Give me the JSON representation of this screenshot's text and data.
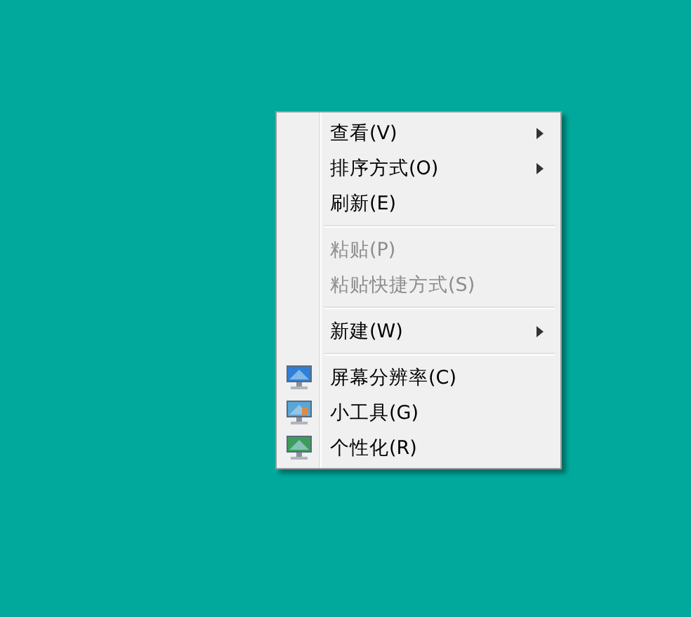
{
  "context_menu": {
    "items": [
      {
        "kind": "item",
        "label": "查看(V)",
        "submenu": true,
        "disabled": false,
        "icon": false
      },
      {
        "kind": "item",
        "label": "排序方式(O)",
        "submenu": true,
        "disabled": false,
        "icon": false
      },
      {
        "kind": "item",
        "label": "刷新(E)",
        "submenu": false,
        "disabled": false,
        "icon": false
      },
      {
        "kind": "separator"
      },
      {
        "kind": "item",
        "label": "粘贴(P)",
        "submenu": false,
        "disabled": true,
        "icon": false
      },
      {
        "kind": "item",
        "label": "粘贴快捷方式(S)",
        "submenu": false,
        "disabled": true,
        "icon": false
      },
      {
        "kind": "separator"
      },
      {
        "kind": "item",
        "label": "新建(W)",
        "submenu": true,
        "disabled": false,
        "icon": false
      },
      {
        "kind": "separator"
      },
      {
        "kind": "item",
        "label": "屏幕分辨率(C)",
        "submenu": false,
        "disabled": false,
        "icon": true
      },
      {
        "kind": "item",
        "label": "小工具(G)",
        "submenu": false,
        "disabled": false,
        "icon": true
      },
      {
        "kind": "item",
        "label": "个性化(R)",
        "submenu": false,
        "disabled": false,
        "icon": true
      }
    ]
  }
}
